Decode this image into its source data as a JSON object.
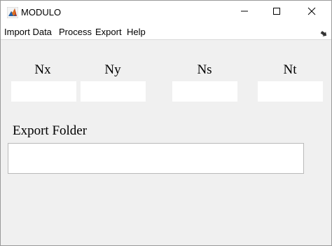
{
  "window": {
    "title": "MODULO",
    "app_icon": "matlab-icon",
    "controls": {
      "minimize_icon": "minimize-icon",
      "maximize_icon": "maximize-icon",
      "close_icon": "close-icon"
    }
  },
  "menubar": {
    "items": [
      {
        "label": "Import Data"
      },
      {
        "label": "Process"
      },
      {
        "label": "Export"
      },
      {
        "label": "Help"
      }
    ],
    "dock_icon": "dock-arrow-icon"
  },
  "parameters": {
    "nx": {
      "label": "Nx",
      "value": ""
    },
    "ny": {
      "label": "Ny",
      "value": ""
    },
    "ns": {
      "label": "Ns",
      "value": ""
    },
    "nt": {
      "label": "Nt",
      "value": ""
    }
  },
  "export": {
    "label": "Export Folder",
    "value": ""
  },
  "colors": {
    "background": "#f0f0f0",
    "titlebar": "#ffffff",
    "field": "#ffffff"
  }
}
